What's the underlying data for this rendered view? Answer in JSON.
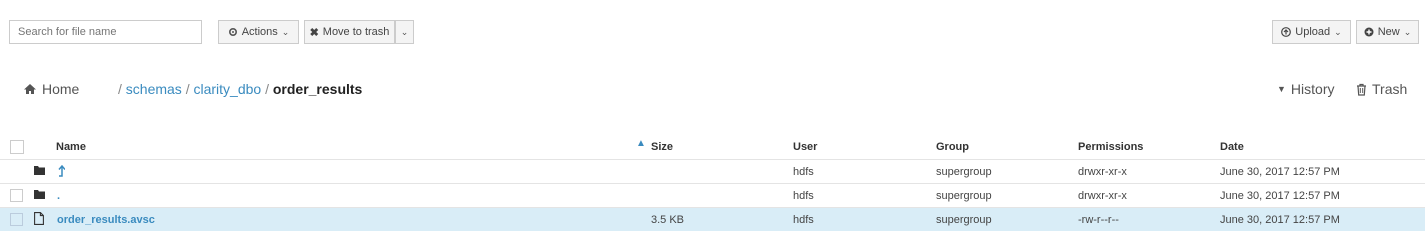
{
  "toolbar": {
    "search_placeholder": "Search for file name",
    "actions_label": "Actions",
    "move_to_trash_label": "Move to trash",
    "upload_label": "Upload",
    "new_label": "New"
  },
  "breadcrumb": {
    "home": "Home",
    "items": [
      {
        "sep": "/",
        "label": "schemas"
      },
      {
        "sep": "/",
        "label": "clarity_dbo"
      },
      {
        "sep": "/",
        "label": "order_results"
      }
    ]
  },
  "right_nav": {
    "history": "History",
    "trash": "Trash"
  },
  "table": {
    "columns": {
      "name": "Name",
      "size": "Size",
      "user": "User",
      "group": "Group",
      "permissions": "Permissions",
      "date": "Date"
    },
    "rows": [
      {
        "name": "",
        "size": "",
        "user": "hdfs",
        "group": "supergroup",
        "permissions": "drwxr-xr-x",
        "date": "June 30, 2017 12:57 PM"
      },
      {
        "name": ".",
        "size": "",
        "user": "hdfs",
        "group": "supergroup",
        "permissions": "drwxr-xr-x",
        "date": "June 30, 2017 12:57 PM"
      },
      {
        "name": "order_results.avsc",
        "size": "3.5 KB",
        "user": "hdfs",
        "group": "supergroup",
        "permissions": "-rw-r--r--",
        "date": "June 30, 2017 12:57 PM"
      }
    ]
  },
  "icons": {
    "folder": "folder-icon",
    "file": "file-icon",
    "up": "level-up-icon"
  },
  "colors": {
    "link": "#3a8bbf",
    "selected_row": "#d9edf7"
  }
}
